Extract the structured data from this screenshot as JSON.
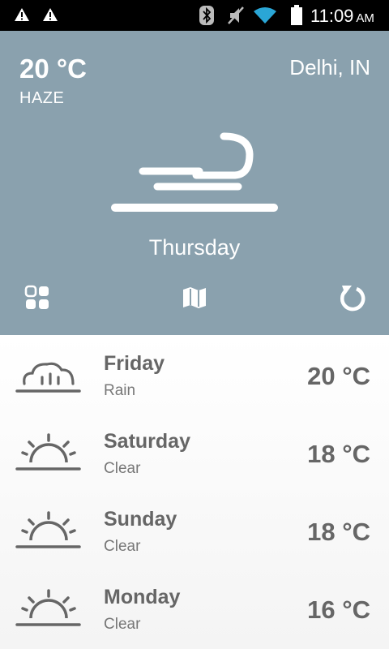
{
  "status_bar": {
    "time": "11:09",
    "ampm": "AM",
    "icons": [
      "warning-icon",
      "warning-icon",
      "bluetooth-icon",
      "mute-icon",
      "wifi-icon",
      "battery-icon"
    ]
  },
  "current": {
    "temperature": "20 °C",
    "condition": "HAZE",
    "location": "Delhi, IN",
    "day": "Thursday",
    "icon": "wind-icon"
  },
  "toolbar": {
    "items": [
      "grid-icon",
      "map-icon",
      "refresh-icon"
    ]
  },
  "forecast": [
    {
      "day": "Friday",
      "condition": "Rain",
      "temperature": "20 °C",
      "icon": "cloud-icon"
    },
    {
      "day": "Saturday",
      "condition": "Clear",
      "temperature": "18 °C",
      "icon": "sunrise-icon"
    },
    {
      "day": "Sunday",
      "condition": "Clear",
      "temperature": "18 °C",
      "icon": "sunrise-icon"
    },
    {
      "day": "Monday",
      "condition": "Clear",
      "temperature": "16 °C",
      "icon": "sunrise-icon"
    }
  ],
  "colors": {
    "header_bg": "#8aa1ae",
    "status_bg": "#000000",
    "text_dark": "#666666"
  }
}
